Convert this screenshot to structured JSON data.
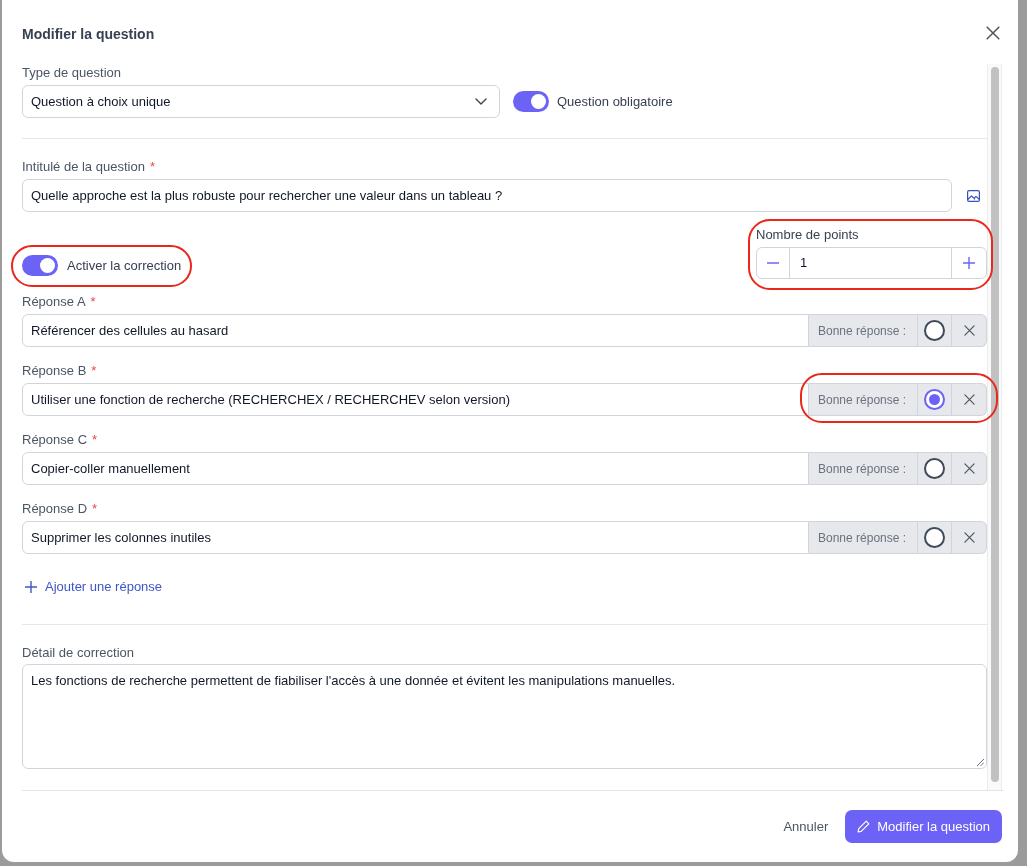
{
  "dialog": {
    "title": "Modifier la question"
  },
  "question_type": {
    "label": "Type de question",
    "value": "Question à choix unique"
  },
  "mandatory_toggle": {
    "label": "Question obligatoire",
    "on": true
  },
  "question_text": {
    "label": "Intitulé de la question",
    "required_mark": "*",
    "value": "Quelle approche est la plus robuste pour rechercher une valeur dans un tableau ?"
  },
  "correction_toggle": {
    "label": "Activer la correction",
    "on": true,
    "highlighted": true
  },
  "points": {
    "label": "Nombre de points",
    "value": "1",
    "highlighted": true
  },
  "answers": [
    {
      "label": "Réponse A",
      "required_mark": "*",
      "value": "Référencer des cellules au hasard",
      "correct_label": "Bonne réponse :",
      "selected": false,
      "highlighted": false
    },
    {
      "label": "Réponse B",
      "required_mark": "*",
      "value": "Utiliser une fonction de recherche (RECHERCHEX / RECHERCHEV selon version)",
      "correct_label": "Bonne réponse :",
      "selected": true,
      "highlighted": true
    },
    {
      "label": "Réponse C",
      "required_mark": "*",
      "value": "Copier-coller manuellement",
      "correct_label": "Bonne réponse :",
      "selected": false,
      "highlighted": false
    },
    {
      "label": "Réponse D",
      "required_mark": "*",
      "value": "Supprimer les colonnes inutiles",
      "correct_label": "Bonne réponse :",
      "selected": false,
      "highlighted": false
    }
  ],
  "add_answer": {
    "label": "Ajouter une réponse"
  },
  "correction_detail": {
    "label": "Détail de correction",
    "value": "Les fonctions de recherche permettent de fiabiliser l'accès à une donnée et évitent les manipulations manuelles."
  },
  "footer": {
    "cancel": "Annuler",
    "submit": "Modifier la question"
  }
}
